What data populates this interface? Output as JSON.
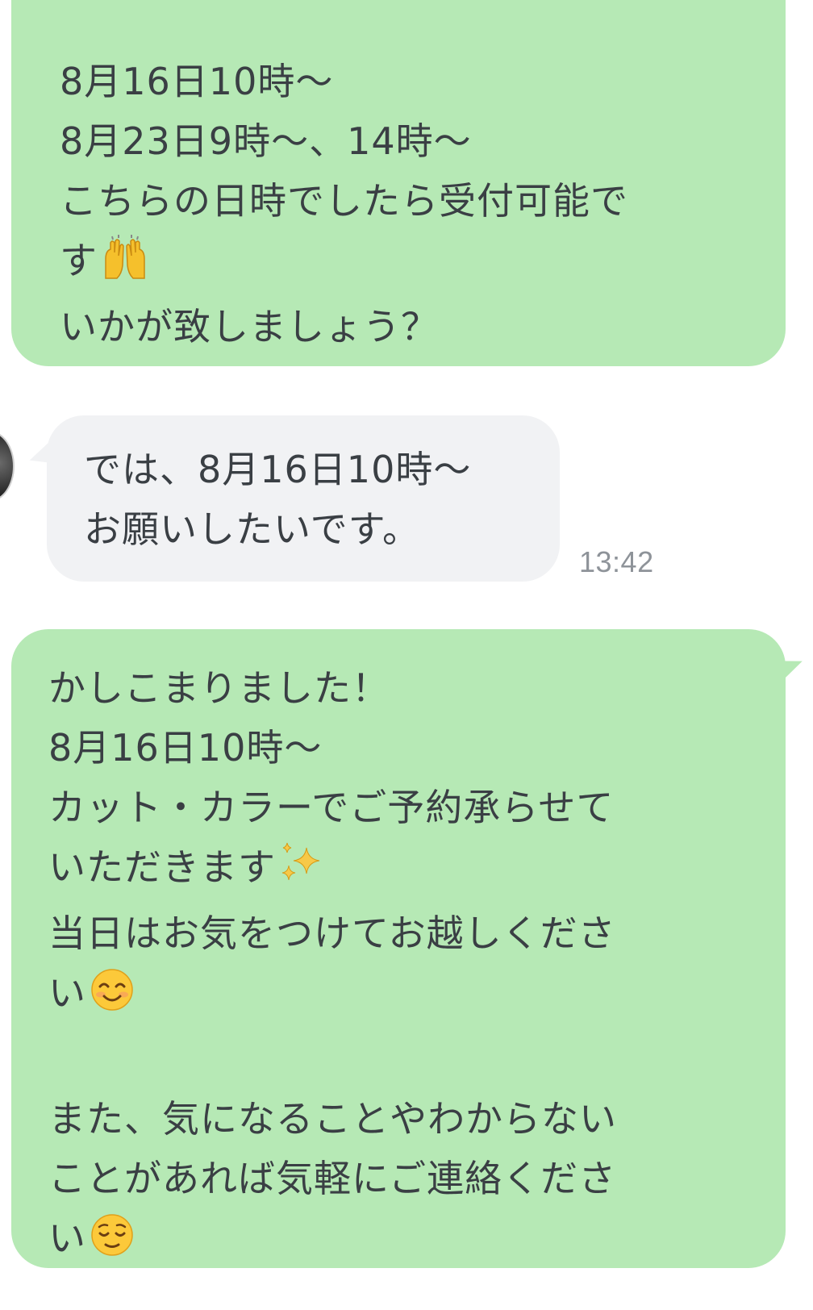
{
  "messages": [
    {
      "sender": "shop",
      "lines": [
        "8月16日10時〜",
        "8月23日9時〜、14時〜",
        "こちらの日時でしたら受付可能で",
        "す",
        "いかが致しましょう？"
      ],
      "emoji": {
        "line_4": "raising-hands-icon"
      }
    },
    {
      "sender": "customer",
      "lines": [
        "では、8月16日10時〜",
        "お願いしたいです。"
      ],
      "time": "13:42"
    },
    {
      "sender": "shop",
      "lines": [
        "かしこまりました！",
        "8月16日10時〜",
        "カット・カラーでご予約承らせて",
        "いただきます",
        "当日はお気をつけてお越しくださ",
        "い",
        "",
        "また、気になることやわからない",
        "ことがあれば気軽にご連絡くださ",
        "い"
      ],
      "emoji": {
        "line_4": "sparkles-icon",
        "line_6": "smiling-face-icon",
        "line_10": "relieved-face-icon"
      }
    }
  ],
  "colors": {
    "sent_bubble": "#b6e9b5",
    "received_bubble": "#f1f2f4",
    "text": "#3a3f44",
    "timestamp": "#8e9399"
  }
}
